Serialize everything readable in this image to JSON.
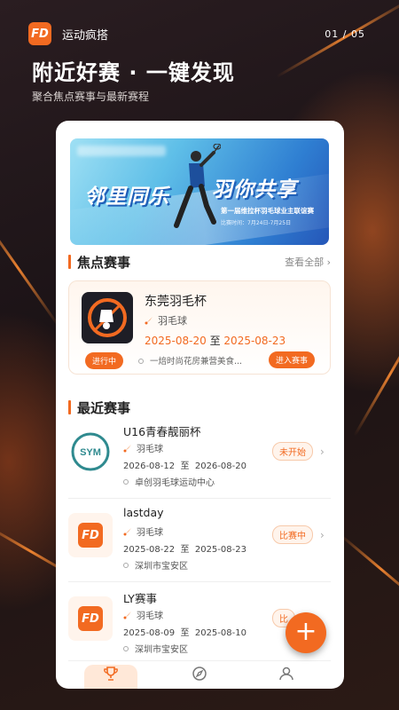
{
  "header": {
    "app_name": "运动疯搭",
    "logo_text": "FD",
    "pager": "01 / 05",
    "headline": "附近好赛 · 一键发现",
    "subline": "聚合焦点赛事与最新赛程"
  },
  "banner": {
    "slogan_left": "邻里同乐",
    "slogan_right": "羽你共享",
    "event": "第一届维拉杯羽毛球业主联谊赛",
    "dates": "比赛时间：7月24日-7月25日"
  },
  "featured": {
    "section_title": "焦点赛事",
    "see_all": "查看全部 ›",
    "name": "东莞羽毛杯",
    "sport": "羽毛球",
    "start": "2025-08-20",
    "to": "至",
    "end": "2025-08-23",
    "status": "进行中",
    "venue": "一焙时尚花房兼营美食...",
    "enter": "进入赛事"
  },
  "recent": {
    "section_title": "最近赛事",
    "to": "至",
    "items": [
      {
        "name": "U16青春靓丽杯",
        "sport": "羽毛球",
        "start": "2026-08-12",
        "end": "2026-08-20",
        "venue": "卓创羽毛球运动中心",
        "status": "未开始",
        "logo": "SYM"
      },
      {
        "name": "lastday",
        "sport": "羽毛球",
        "start": "2025-08-22",
        "end": "2025-08-23",
        "venue": "深圳市宝安区",
        "status": "比赛中",
        "logo": "FD"
      },
      {
        "name": "LY赛事",
        "sport": "羽毛球",
        "start": "2025-08-09",
        "end": "2025-08-10",
        "venue": "深圳市宝安区",
        "status": "比",
        "logo": "FD"
      }
    ]
  },
  "fab_label": "+",
  "icons": {
    "shuttlecock": "shuttlecock-icon",
    "pin": "location-pin-icon",
    "trophy": "trophy-icon",
    "compass": "compass-icon",
    "user": "user-icon"
  },
  "colors": {
    "accent": "#f26a21",
    "background": "#1b1416"
  }
}
